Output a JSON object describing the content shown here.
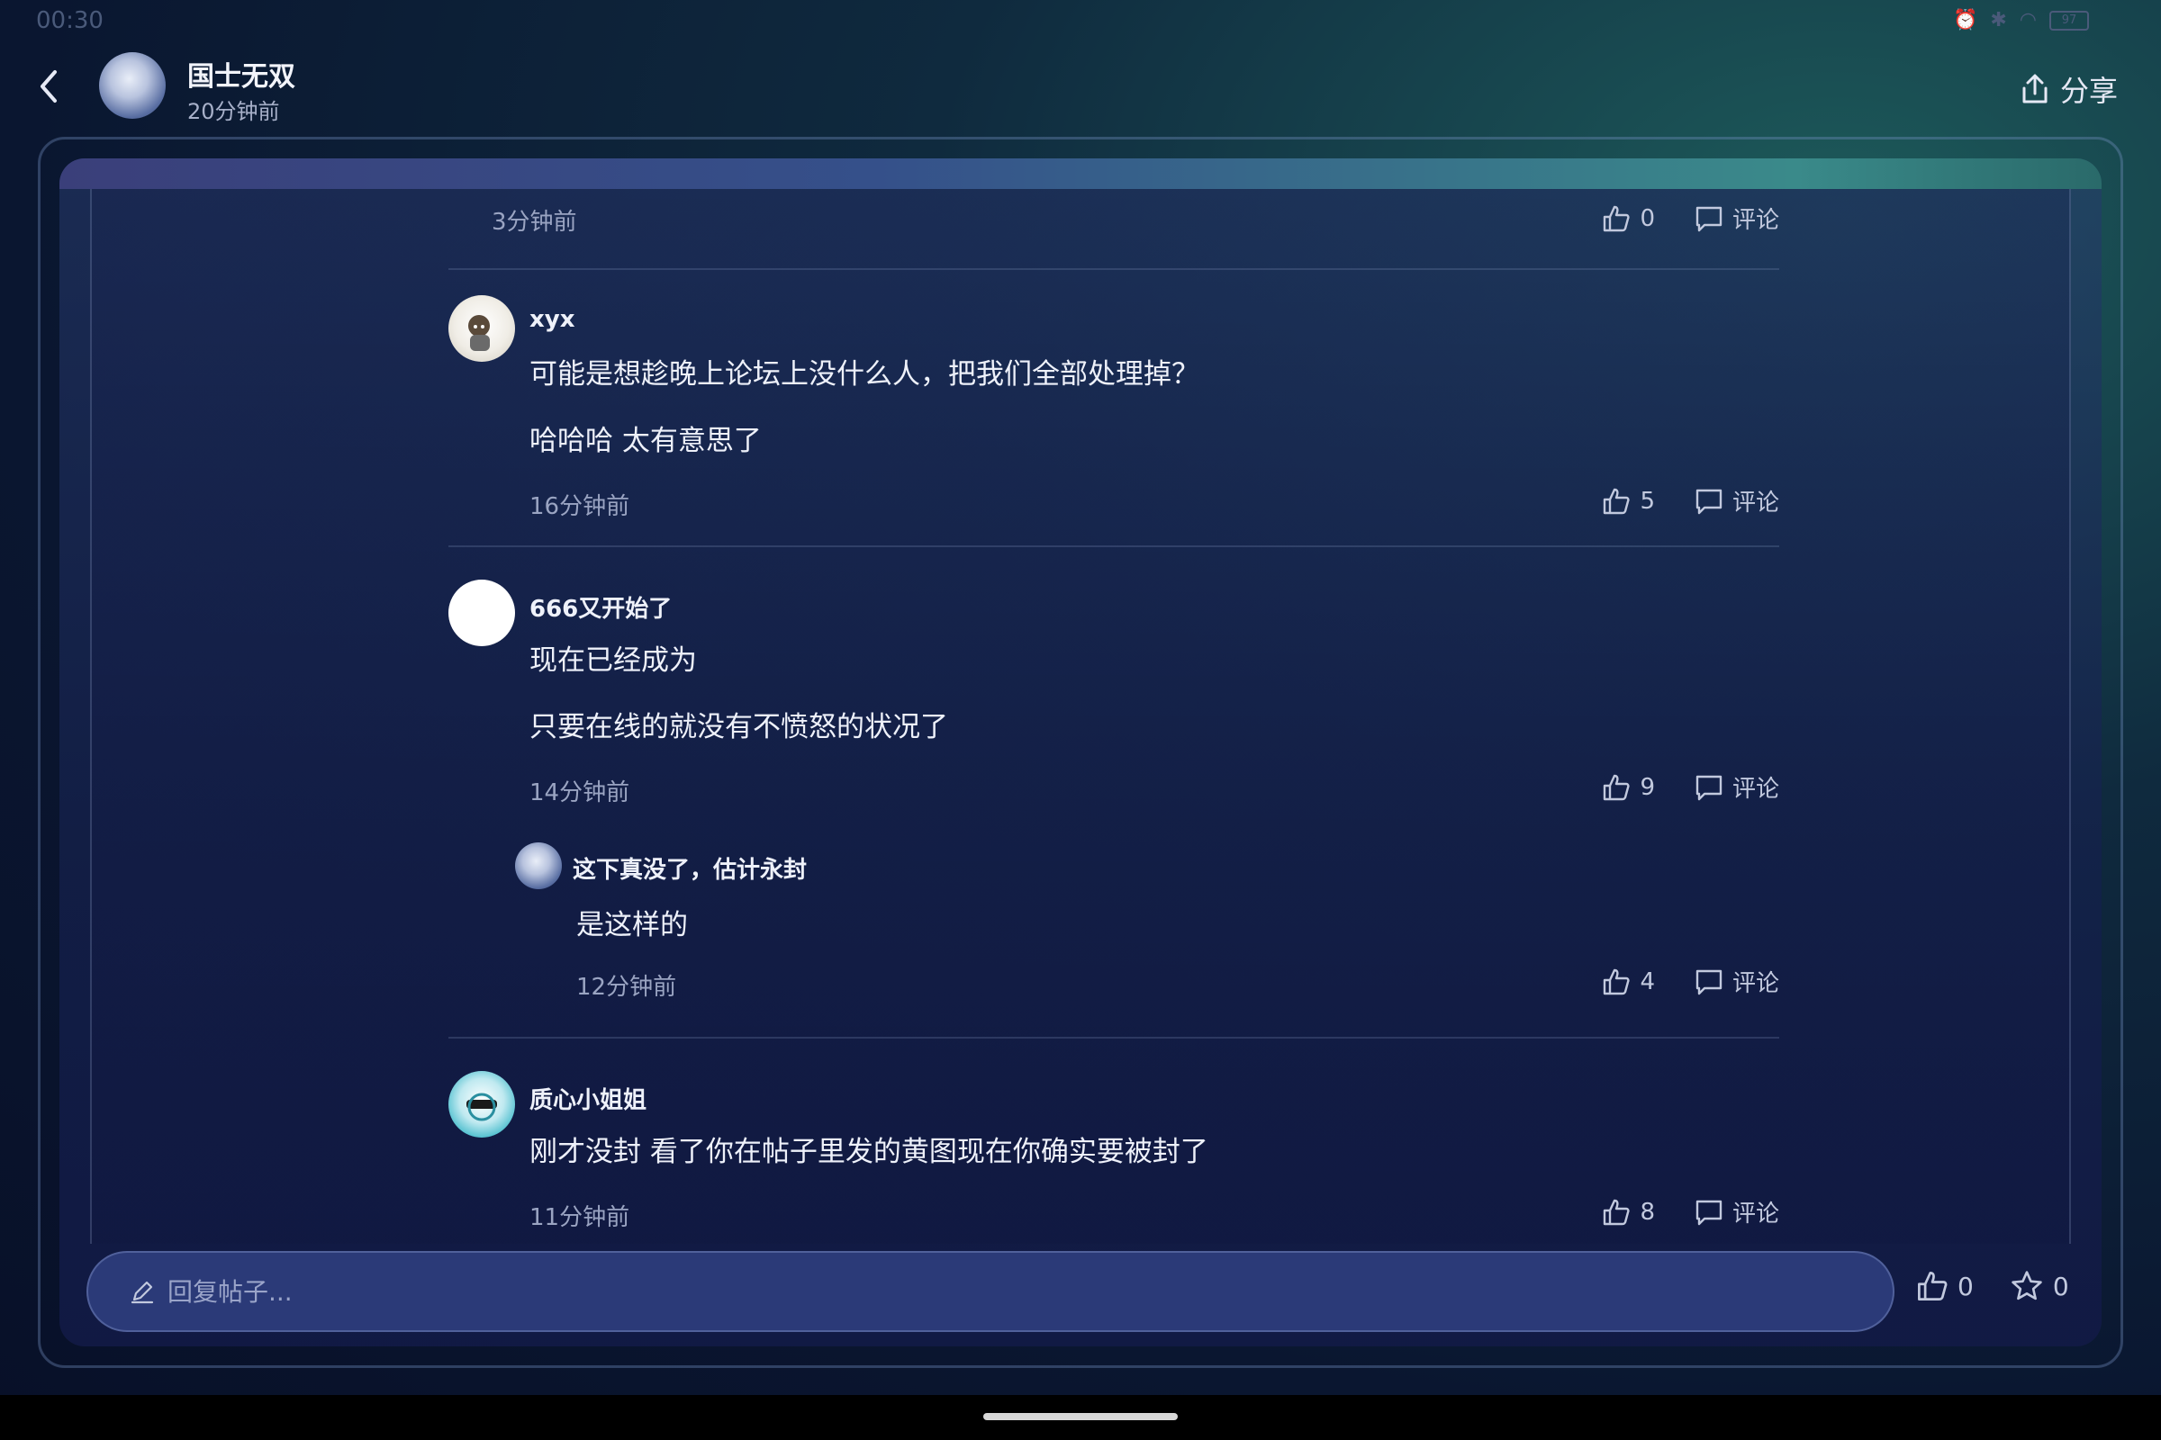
{
  "status_bar": {
    "time": "00:30",
    "battery": "97"
  },
  "header": {
    "author_name": "国士无双",
    "author_time": "20分钟前",
    "share_label": "分享"
  },
  "comments": [
    {
      "id": "c0",
      "time": "3分钟前",
      "likes": "0",
      "comment_label": "评论"
    },
    {
      "id": "c1",
      "name": "xyx",
      "lines": [
        "可能是想趁晚上论坛上没什么人，把我们全部处理掉？",
        "哈哈哈   太有意思了"
      ],
      "time": "16分钟前",
      "likes": "5",
      "comment_label": "评论"
    },
    {
      "id": "c2",
      "name": "666又开始了",
      "lines": [
        "现在已经成为",
        "只要在线的就没有不愤怒的状况了"
      ],
      "time": "14分钟前",
      "likes": "9",
      "comment_label": "评论"
    },
    {
      "id": "c3",
      "name": "这下真没了，估计永封",
      "lines": [
        "是这样的"
      ],
      "time": "12分钟前",
      "likes": "4",
      "comment_label": "评论"
    },
    {
      "id": "c4",
      "name": "质心小姐姐",
      "lines": [
        "刚才没封  看了你在帖子里发的黄图现在你确实要被封了"
      ],
      "time": "11分钟前",
      "likes": "8",
      "comment_label": "评论"
    }
  ],
  "reply_bar": {
    "placeholder": "回复帖子..."
  },
  "bottom_actions": {
    "like_count": "0",
    "favorite_count": "0"
  },
  "icons": [
    "back-icon",
    "share-icon",
    "thumbs-up-icon",
    "comment-icon",
    "pencil-icon",
    "star-icon"
  ],
  "colors": {
    "background": "#0a1630",
    "card": "#1a2656",
    "reply_bar": "#2b3a78",
    "text": "#eef1fa",
    "muted": "#9aa4c2"
  }
}
